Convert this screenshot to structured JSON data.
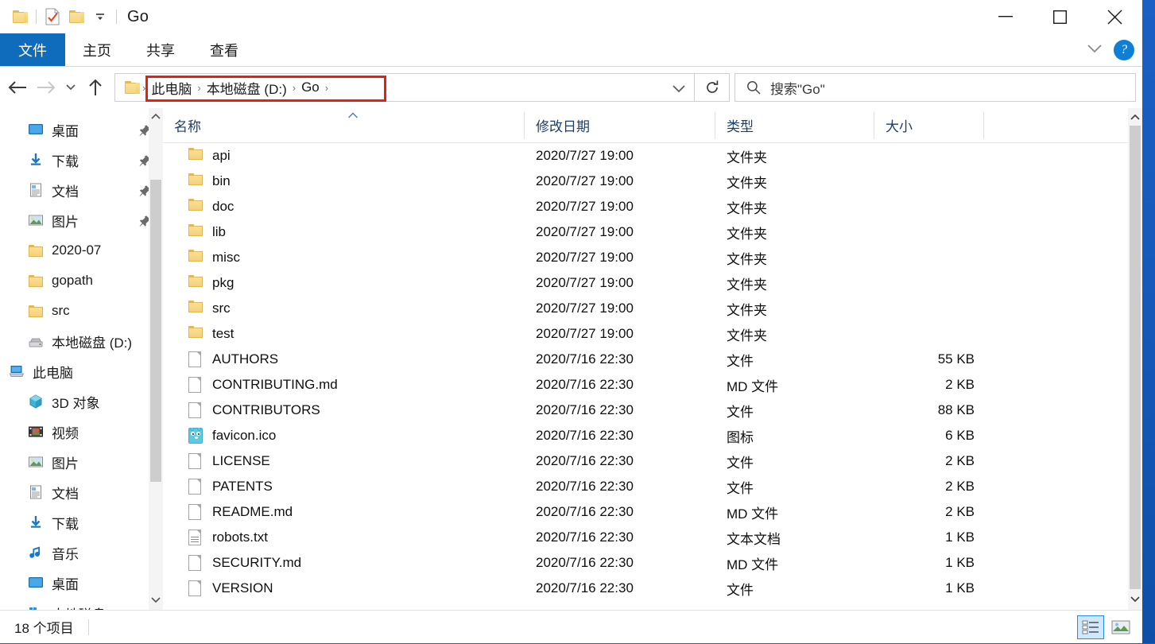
{
  "window": {
    "title": "Go",
    "quick_access": [
      {
        "name": "folder-icon",
        "label": "文件夹"
      },
      {
        "name": "properties-icon",
        "label": "属性"
      },
      {
        "name": "new-folder-icon",
        "label": "新建文件夹"
      },
      {
        "name": "customize-dropdown-icon",
        "label": "自定义快速访问工具栏"
      }
    ],
    "controls": {
      "minimize": "—",
      "maximize": "□",
      "close": "✕"
    }
  },
  "ribbon": {
    "tabs": [
      {
        "label": "文件",
        "active": true
      },
      {
        "label": "主页",
        "active": false
      },
      {
        "label": "共享",
        "active": false
      },
      {
        "label": "查看",
        "active": false
      }
    ],
    "collapse_label": "展开功能区",
    "help_label": "?"
  },
  "navigation": {
    "back_label": "后退",
    "forward_label": "前进",
    "recent_label": "最近浏览的位置",
    "up_label": "上移到上一级",
    "refresh_label": "刷新",
    "highlight_color": "#ee1c10"
  },
  "address_bar": {
    "breadcrumbs": [
      "此电脑",
      "本地磁盘 (D:)",
      "Go"
    ],
    "separator": "›",
    "dropdown_label": "以前的位置"
  },
  "search": {
    "placeholder": "搜索\"Go\"",
    "icon": "search-icon"
  },
  "sidebar": {
    "items": [
      {
        "label": "桌面",
        "icon": "desktop-icon",
        "level": 1,
        "pinned": true
      },
      {
        "label": "下载",
        "icon": "download-icon",
        "level": 1,
        "pinned": true
      },
      {
        "label": "文档",
        "icon": "documents-icon",
        "level": 1,
        "pinned": true
      },
      {
        "label": "图片",
        "icon": "pictures-icon",
        "level": 1,
        "pinned": true
      },
      {
        "label": "2020-07",
        "icon": "folder-icon",
        "level": 1,
        "pinned": false
      },
      {
        "label": "gopath",
        "icon": "folder-icon",
        "level": 1,
        "pinned": false
      },
      {
        "label": "src",
        "icon": "folder-icon",
        "level": 1,
        "pinned": false
      },
      {
        "label": "本地磁盘 (D:)",
        "icon": "drive-icon",
        "level": 1,
        "pinned": false
      },
      {
        "label": "此电脑",
        "icon": "this-pc-icon",
        "level": 0,
        "pinned": false
      },
      {
        "label": "3D 对象",
        "icon": "3d-objects-icon",
        "level": 1,
        "pinned": false
      },
      {
        "label": "视频",
        "icon": "videos-icon",
        "level": 1,
        "pinned": false
      },
      {
        "label": "图片",
        "icon": "pictures-icon",
        "level": 1,
        "pinned": false
      },
      {
        "label": "文档",
        "icon": "documents-icon",
        "level": 1,
        "pinned": false
      },
      {
        "label": "下载",
        "icon": "download-icon",
        "level": 1,
        "pinned": false
      },
      {
        "label": "音乐",
        "icon": "music-icon",
        "level": 1,
        "pinned": false
      },
      {
        "label": "桌面",
        "icon": "desktop-icon",
        "level": 1,
        "pinned": false
      },
      {
        "label": "本地磁盘 (C:)",
        "icon": "windows-drive-icon",
        "level": 1,
        "pinned": false
      }
    ]
  },
  "file_list": {
    "columns": [
      {
        "label": "名称",
        "key": "name"
      },
      {
        "label": "修改日期",
        "key": "date"
      },
      {
        "label": "类型",
        "key": "type"
      },
      {
        "label": "大小",
        "key": "size"
      }
    ],
    "sort_column": "名称",
    "sort_direction": "asc",
    "rows": [
      {
        "name": "api",
        "date": "2020/7/27 19:00",
        "type": "文件夹",
        "size": "",
        "icon": "folder-icon"
      },
      {
        "name": "bin",
        "date": "2020/7/27 19:00",
        "type": "文件夹",
        "size": "",
        "icon": "folder-icon"
      },
      {
        "name": "doc",
        "date": "2020/7/27 19:00",
        "type": "文件夹",
        "size": "",
        "icon": "folder-icon"
      },
      {
        "name": "lib",
        "date": "2020/7/27 19:00",
        "type": "文件夹",
        "size": "",
        "icon": "folder-icon"
      },
      {
        "name": "misc",
        "date": "2020/7/27 19:00",
        "type": "文件夹",
        "size": "",
        "icon": "folder-icon"
      },
      {
        "name": "pkg",
        "date": "2020/7/27 19:00",
        "type": "文件夹",
        "size": "",
        "icon": "folder-icon"
      },
      {
        "name": "src",
        "date": "2020/7/27 19:00",
        "type": "文件夹",
        "size": "",
        "icon": "folder-icon"
      },
      {
        "name": "test",
        "date": "2020/7/27 19:00",
        "type": "文件夹",
        "size": "",
        "icon": "folder-icon"
      },
      {
        "name": "AUTHORS",
        "date": "2020/7/16 22:30",
        "type": "文件",
        "size": "55 KB",
        "icon": "file-icon"
      },
      {
        "name": "CONTRIBUTING.md",
        "date": "2020/7/16 22:30",
        "type": "MD 文件",
        "size": "2 KB",
        "icon": "file-icon"
      },
      {
        "name": "CONTRIBUTORS",
        "date": "2020/7/16 22:30",
        "type": "文件",
        "size": "88 KB",
        "icon": "file-icon"
      },
      {
        "name": "favicon.ico",
        "date": "2020/7/16 22:30",
        "type": "图标",
        "size": "6 KB",
        "icon": "gopher-icon"
      },
      {
        "name": "LICENSE",
        "date": "2020/7/16 22:30",
        "type": "文件",
        "size": "2 KB",
        "icon": "file-icon"
      },
      {
        "name": "PATENTS",
        "date": "2020/7/16 22:30",
        "type": "文件",
        "size": "2 KB",
        "icon": "file-icon"
      },
      {
        "name": "README.md",
        "date": "2020/7/16 22:30",
        "type": "MD 文件",
        "size": "2 KB",
        "icon": "file-icon"
      },
      {
        "name": "robots.txt",
        "date": "2020/7/16 22:30",
        "type": "文本文档",
        "size": "1 KB",
        "icon": "text-file-icon"
      },
      {
        "name": "SECURITY.md",
        "date": "2020/7/16 22:30",
        "type": "MD 文件",
        "size": "1 KB",
        "icon": "file-icon"
      },
      {
        "name": "VERSION",
        "date": "2020/7/16 22:30",
        "type": "文件",
        "size": "1 KB",
        "icon": "file-icon"
      }
    ]
  },
  "status_bar": {
    "item_count": "18 个项目",
    "views": [
      {
        "name": "details-view",
        "label": "详细信息",
        "active": true
      },
      {
        "name": "large-icons-view",
        "label": "大图标",
        "active": false
      }
    ]
  }
}
